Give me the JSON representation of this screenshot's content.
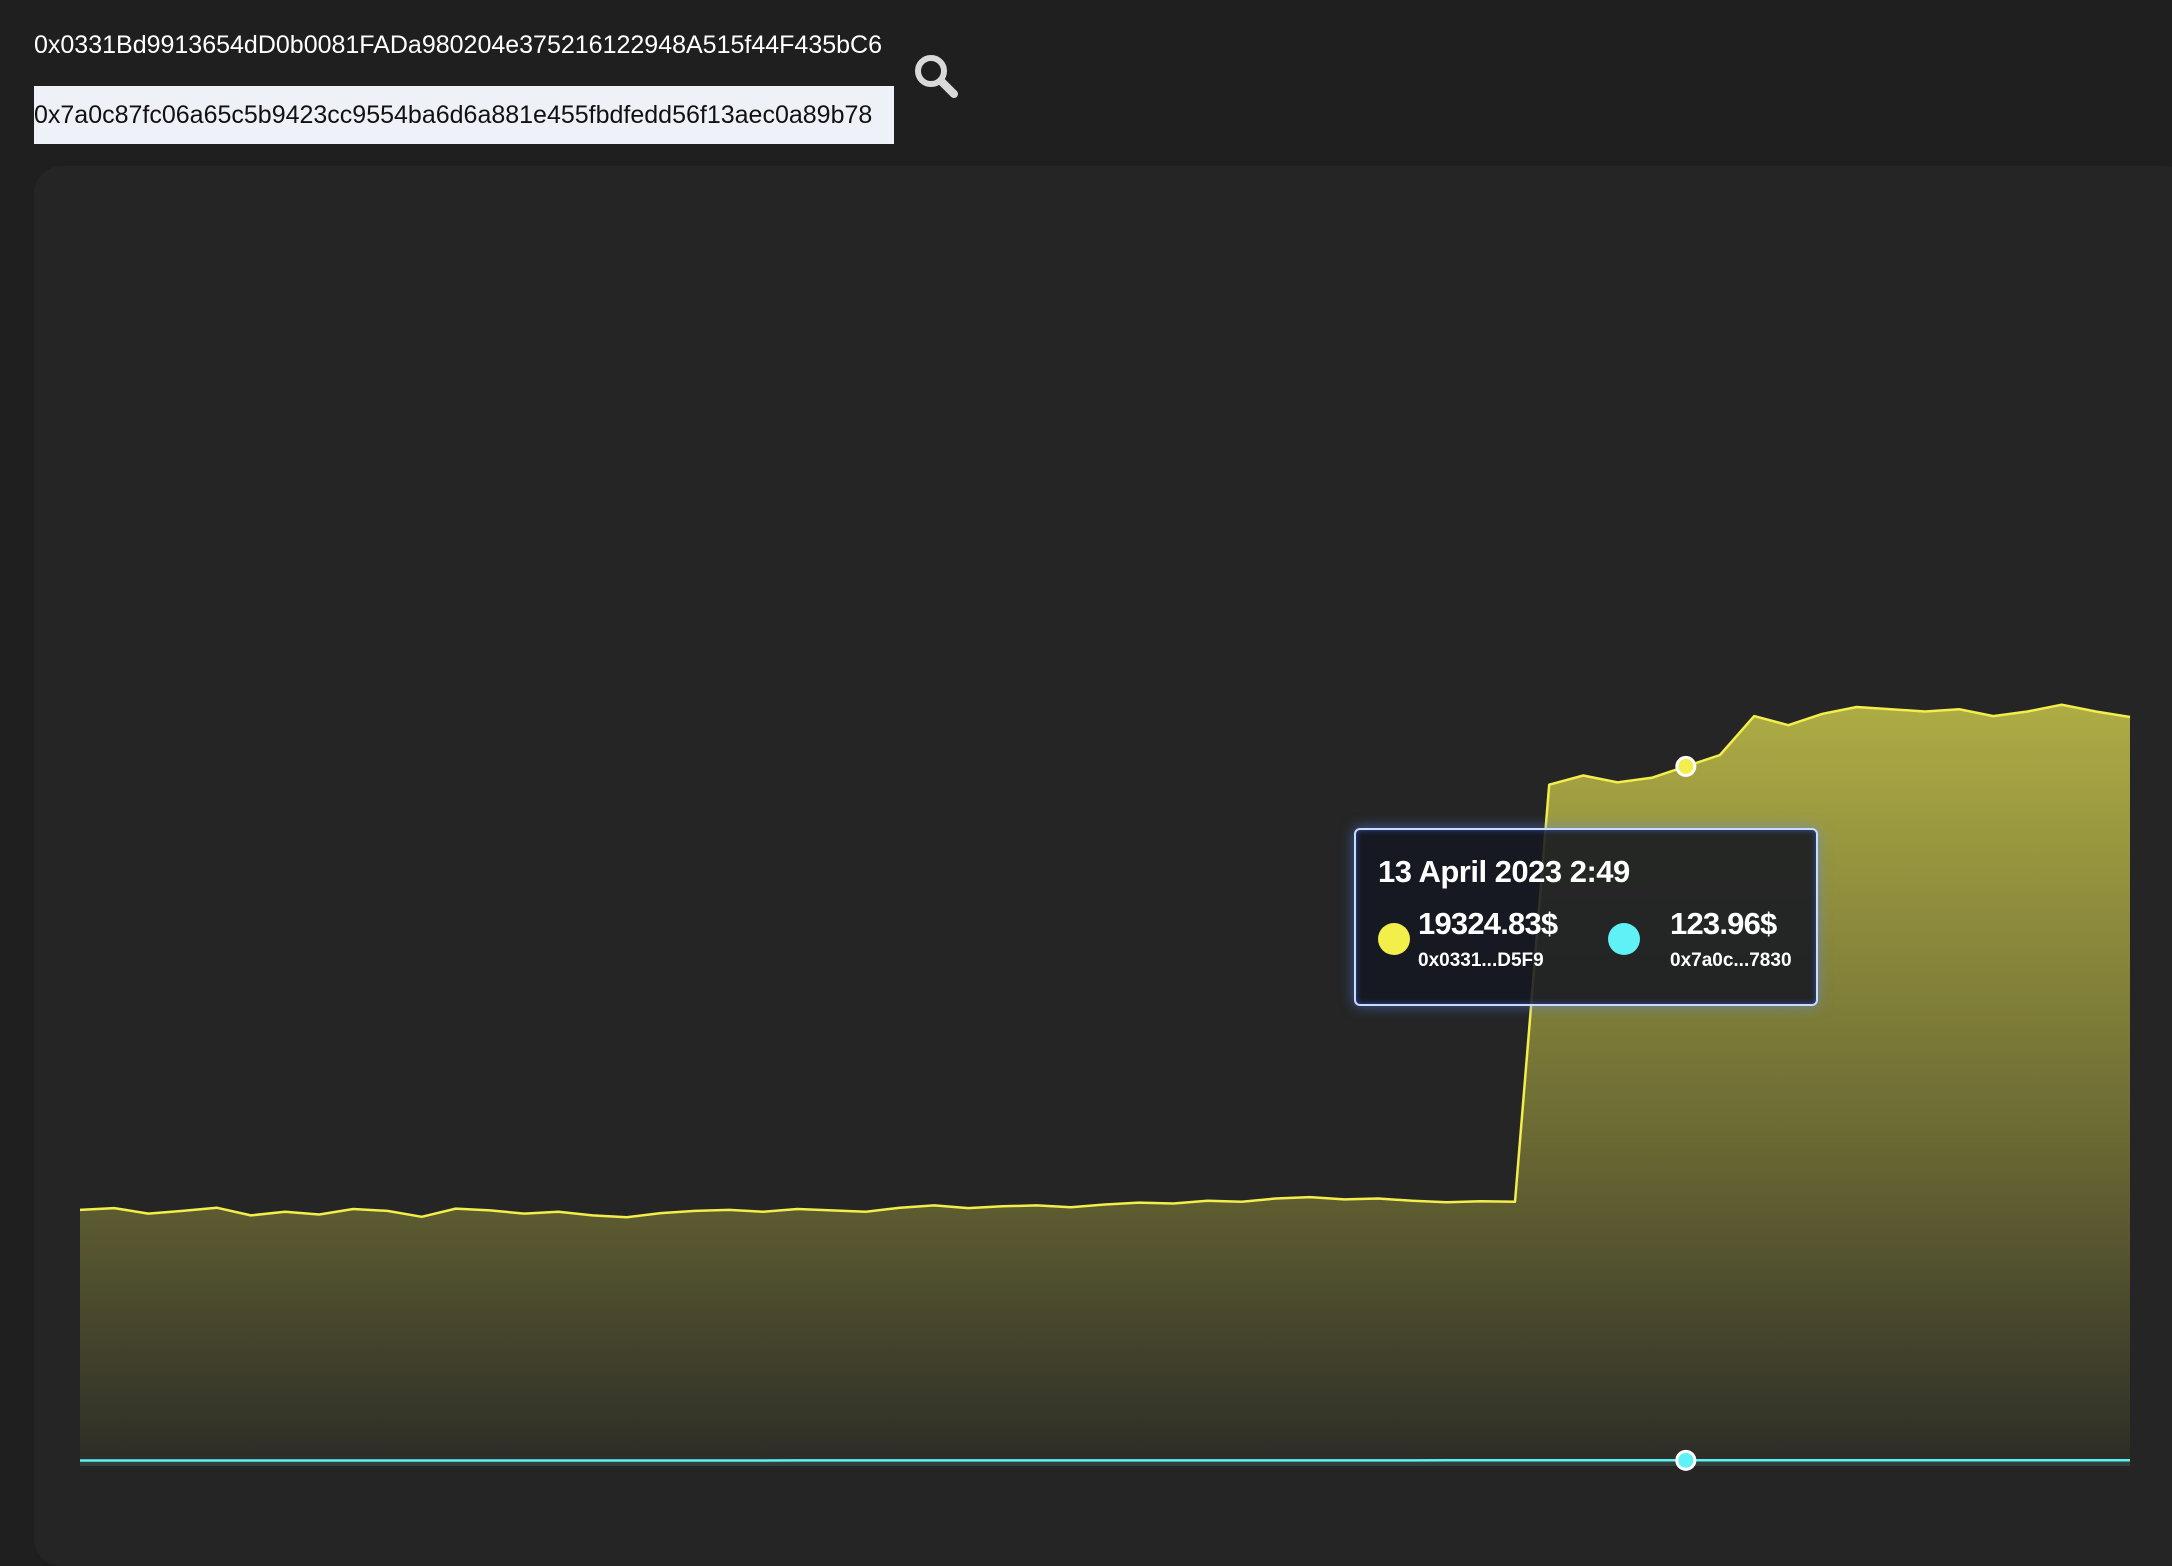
{
  "inputs": {
    "address_1": "0x0331Bd9913654dD0b0081FADa980204e375216122948A515f44F435bC6",
    "address_2": "0x7a0c87fc06a65c5b9423cc9554ba6d6a881e455fbdfedd56f13aec0a89b78"
  },
  "search": {
    "icon": "search-icon"
  },
  "colors": {
    "page_bg": "#1f1f1f",
    "card_bg": "#252525",
    "series_1": "#f2ee4a",
    "series_2": "#5ff1f5",
    "tooltip_border": "#c9dcff"
  },
  "tooltip": {
    "date": "13 April 2023 2:49",
    "entries": [
      {
        "value": "19324.83$",
        "address": "0x0331...D5F9",
        "color": "#f2ee4a"
      },
      {
        "value": "123.96$",
        "address": "0x7a0c...7830",
        "color": "#5ff1f5"
      }
    ]
  },
  "chart_data": {
    "type": "area",
    "title": "",
    "xlabel": "",
    "ylabel": "",
    "grid": false,
    "legend": "none",
    "hover_index": 47,
    "x": [
      0,
      1,
      2,
      3,
      4,
      5,
      6,
      7,
      8,
      9,
      10,
      11,
      12,
      13,
      14,
      15,
      16,
      17,
      18,
      19,
      20,
      21,
      22,
      23,
      24,
      25,
      26,
      27,
      28,
      29,
      30,
      31,
      32,
      33,
      34,
      35,
      36,
      37,
      38,
      39,
      40,
      41,
      42,
      43,
      44,
      45,
      46,
      47,
      48,
      49,
      50,
      51,
      52,
      53,
      54,
      55,
      56,
      57,
      58,
      59,
      60
    ],
    "ylim": [
      0,
      25500
    ],
    "series": [
      {
        "color": "#f2ee4a",
        "values": [
          5600,
          5640,
          5520,
          5580,
          5650,
          5480,
          5560,
          5500,
          5620,
          5580,
          5450,
          5630,
          5590,
          5520,
          5560,
          5480,
          5440,
          5530,
          5580,
          5600,
          5560,
          5620,
          5590,
          5560,
          5650,
          5700,
          5640,
          5680,
          5700,
          5660,
          5720,
          5760,
          5740,
          5800,
          5780,
          5850,
          5880,
          5830,
          5850,
          5800,
          5770,
          5790,
          5780,
          14900,
          15100,
          14950,
          15050,
          15300,
          15550,
          16400,
          16200,
          16450,
          16600,
          16550,
          16500,
          16550,
          16400,
          16500,
          16650,
          16500,
          16380
        ]
      },
      {
        "color": "#5ff1f5",
        "values": [
          120,
          120,
          120,
          120,
          120,
          120,
          120,
          120,
          120,
          120,
          120,
          120,
          120,
          120,
          120,
          120,
          120,
          120,
          120,
          120,
          120,
          122,
          123,
          123,
          123,
          123,
          123,
          123,
          123,
          123,
          123,
          123,
          123,
          123,
          123,
          123,
          123,
          123,
          123,
          123,
          124,
          124,
          124,
          124,
          124,
          124,
          124,
          124,
          124,
          124,
          124,
          124,
          124,
          124,
          124,
          124,
          124,
          124,
          124,
          124,
          124
        ]
      }
    ]
  }
}
